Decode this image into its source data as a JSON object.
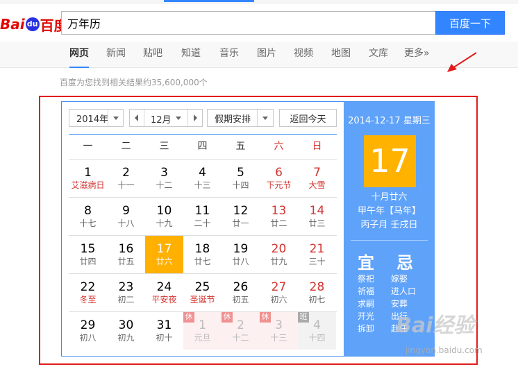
{
  "header": {
    "logo_text_a": "Bai",
    "logo_text_paw": "du",
    "logo_text_b": "百度",
    "search_value": "万年历",
    "search_button": "百度一下"
  },
  "nav": {
    "items": [
      "网页",
      "新闻",
      "贴吧",
      "知道",
      "音乐",
      "图片",
      "视频",
      "地图",
      "文库",
      "更多»"
    ],
    "active": "网页"
  },
  "result_count": "百度为您找到相关结果约35,600,000个",
  "calendar": {
    "year_select": "2014年",
    "month_select": "12月",
    "holiday_select": "假期安排",
    "today_button": "返回今天",
    "weekdays": [
      "一",
      "二",
      "三",
      "四",
      "五",
      "六",
      "日"
    ],
    "weeks": [
      [
        {
          "d": "1",
          "s": "艾滋病日",
          "red": true
        },
        {
          "d": "2",
          "s": "十一"
        },
        {
          "d": "3",
          "s": "十二"
        },
        {
          "d": "4",
          "s": "十三"
        },
        {
          "d": "5",
          "s": "十四"
        },
        {
          "d": "6",
          "s": "下元节",
          "red": true,
          "wknd": true
        },
        {
          "d": "7",
          "s": "大雪",
          "red": true,
          "wknd": true
        }
      ],
      [
        {
          "d": "8",
          "s": "十七"
        },
        {
          "d": "9",
          "s": "十八"
        },
        {
          "d": "10",
          "s": "十九"
        },
        {
          "d": "11",
          "s": "二十"
        },
        {
          "d": "12",
          "s": "廿一"
        },
        {
          "d": "13",
          "s": "廿二",
          "wknd": true
        },
        {
          "d": "14",
          "s": "廿三",
          "wknd": true
        }
      ],
      [
        {
          "d": "15",
          "s": "廿四"
        },
        {
          "d": "16",
          "s": "廿五"
        },
        {
          "d": "17",
          "s": "廿六",
          "today": true
        },
        {
          "d": "18",
          "s": "廿七"
        },
        {
          "d": "19",
          "s": "廿八"
        },
        {
          "d": "20",
          "s": "廿九",
          "wknd": true
        },
        {
          "d": "21",
          "s": "三十",
          "wknd": true
        }
      ],
      [
        {
          "d": "22",
          "s": "冬至",
          "red": true
        },
        {
          "d": "23",
          "s": "初二"
        },
        {
          "d": "24",
          "s": "平安夜",
          "red": true
        },
        {
          "d": "25",
          "s": "圣诞节",
          "red": true
        },
        {
          "d": "26",
          "s": "初五"
        },
        {
          "d": "27",
          "s": "初六",
          "wknd": true
        },
        {
          "d": "28",
          "s": "初七",
          "wknd": true
        }
      ],
      [
        {
          "d": "29",
          "s": "初八"
        },
        {
          "d": "30",
          "s": "初九"
        },
        {
          "d": "31",
          "s": "初十"
        },
        {
          "d": "1",
          "s": "元旦",
          "next": true,
          "badge": "休"
        },
        {
          "d": "2",
          "s": "十二",
          "next": true,
          "badge": "休"
        },
        {
          "d": "3",
          "s": "十三",
          "next": true,
          "badge": "休"
        },
        {
          "d": "4",
          "s": "十四",
          "next": true,
          "badge": "班",
          "ban": true
        }
      ]
    ],
    "side": {
      "date_line": "2014-12-17 星期三",
      "big_day": "17",
      "lunar_1": "十月廿六",
      "lunar_2": "甲午年【马年】",
      "lunar_3": "丙子月 壬戌日",
      "yi_label": "宜",
      "ji_label": "忌",
      "yi_items": [
        "祭祀",
        "祈福",
        "求嗣",
        "开光",
        "拆卸"
      ],
      "ji_items": [
        "嫁娶",
        "进人口",
        "安葬",
        "出行",
        "赴任"
      ]
    }
  },
  "watermark": {
    "text": "Bai经验",
    "url": "jingyan.baidu.com"
  },
  "colors": {
    "accent_blue": "#3385ff",
    "frame_red": "#e21c1c",
    "today_orange": "#ffb001",
    "side_blue": "#5fa2f9"
  }
}
